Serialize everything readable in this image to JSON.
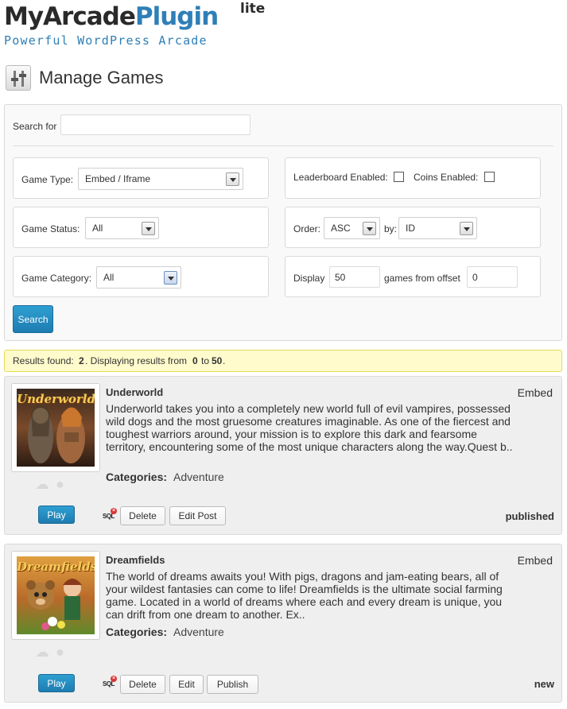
{
  "logo": {
    "main_part1": "MyArcade",
    "main_part2": "Plugin",
    "sup": "lite",
    "tagline": "Powerful WordPress Arcade"
  },
  "page": {
    "title": "Manage Games"
  },
  "filters": {
    "search_label": "Search for",
    "search_value": "",
    "game_type_label": "Game Type:",
    "game_type_value": "Embed / Iframe",
    "leaderboard_label": "Leaderboard Enabled:",
    "leaderboard_checked": false,
    "coins_label": "Coins Enabled:",
    "coins_checked": false,
    "game_status_label": "Game Status:",
    "game_status_value": "All",
    "order_label": "Order:",
    "order_value": "ASC",
    "by_label": "by:",
    "by_value": "ID",
    "game_category_label": "Game Category:",
    "game_category_value": "All",
    "display_label": "Display",
    "display_value": "50",
    "offset_label": "games from offset",
    "offset_value": "0",
    "search_button": "Search"
  },
  "results": {
    "prefix": "Results found:",
    "count": "2",
    "middle": ". Displaying results from",
    "from": "0",
    "to_word": "to",
    "to": "50",
    "suffix": "."
  },
  "games": [
    {
      "title": "Underworld",
      "type": "Embed",
      "description": "Underworld takes you into a completely new world full of evil vampires, possessed wild dogs and the most gruesome creatures imaginable. As one of the fiercest and toughest warriors around, your mission is to explore this dark and fearsome territory, encountering some of the most unique characters along the way.Quest b..",
      "categories_label": "Categories:",
      "categories": "Adventure",
      "thumb_title": "Underworld",
      "play_label": "Play",
      "delete_label": "Delete",
      "edit_label": "Edit Post",
      "status": "published"
    },
    {
      "title": "Dreamfields",
      "type": "Embed",
      "description": "The world of dreams awaits you! With pigs, dragons and jam-eating bears, all of your wildest fantasies can come to life! Dreamfields is the ultimate social farming game. Located in a world of dreams where each and every dream is unique, you can drift from one dream to another. Ex..",
      "categories_label": "Categories:",
      "categories": "Adventure",
      "thumb_title": "Dreamfields",
      "play_label": "Play",
      "delete_label": "Delete",
      "edit_label": "Edit",
      "publish_label": "Publish",
      "status": "new"
    }
  ],
  "icons": {
    "page": "sliders-icon",
    "rating": [
      "thumbs-icon",
      "fire-icon"
    ],
    "sql": "sql-delete-icon"
  },
  "colors": {
    "brand_blue": "#2f7fb7",
    "button_blue": "#2187bd",
    "notice_bg": "#fffbcc",
    "notice_border": "#e6db55"
  }
}
